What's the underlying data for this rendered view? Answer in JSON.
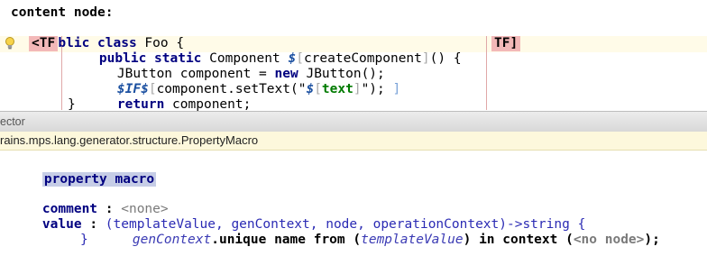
{
  "editor": {
    "header": "content node:",
    "line_class": {
      "kw": "public class",
      "name": "Foo {"
    },
    "tf_open": "<TF",
    "tf_close": "TF]",
    "line_method": {
      "kw": "public static",
      "type": "Component",
      "macro": "$",
      "bracket_open": "[",
      "name": "createComponent",
      "bracket_close": "]",
      "rest": "() {"
    },
    "line_decl": {
      "pre": "JButton component = ",
      "kw": "new",
      "post": " JButton();"
    },
    "line_if": {
      "macro": "$IF$",
      "bracket_open": "[",
      "call": "component.setText(\"",
      "text_macro": "$",
      "text_bracket_open": "[",
      "text_var": "text",
      "text_bracket_close": "]",
      "call_end": "\");",
      "bracket_close": " ]"
    },
    "line_return": {
      "kw": "return",
      "rest": " component;"
    },
    "line_close": "}"
  },
  "inspector": {
    "title": "ector",
    "concept": "rains.mps.lang.generator.structure.PropertyMacro"
  },
  "property_macro": {
    "title": "property macro",
    "comment_label": "comment",
    "colon": ":",
    "comment_value": "<none>",
    "value_label": "value",
    "signature": "(templateValue, genContext, node, operationContext)->string {",
    "body_gen": "genContext",
    "body_unique": ".unique name from (",
    "body_tv": "templateValue",
    "body_in": ") in context (",
    "body_nonode": "<no node>",
    "body_end": ");",
    "close": "}"
  }
}
